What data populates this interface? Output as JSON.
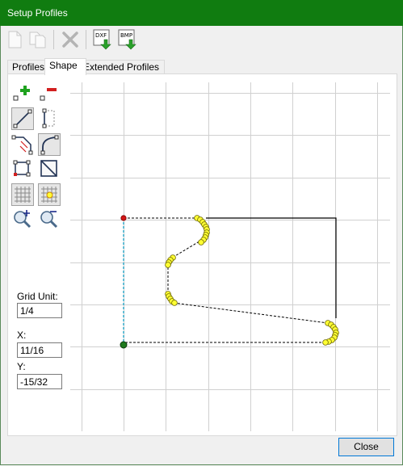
{
  "window": {
    "title": "Setup Profiles"
  },
  "toolbar": {
    "new": "new-profile-icon",
    "copy": "copy-profile-icon",
    "delete": "delete-icon",
    "dxf_label": "DXF",
    "bmp_label": "BMP"
  },
  "tabs": [
    {
      "label": "Profiles",
      "active": false
    },
    {
      "label": "Shape",
      "active": true
    },
    {
      "label": "Extended Profiles",
      "active": false
    }
  ],
  "shape": {
    "grid_unit_label": "Grid Unit:",
    "grid_unit_value": "1/4",
    "x_label": "X:",
    "x_value": "11/16",
    "y_label": "Y:",
    "y_value": "-15/32"
  },
  "buttons": {
    "close": "Close"
  },
  "colors": {
    "titlebar": "#107c10",
    "point_fill": "#ffff33",
    "start_point": "#d11515",
    "end_point": "#1e7a1e",
    "guide_line": "#0aa0c8"
  }
}
